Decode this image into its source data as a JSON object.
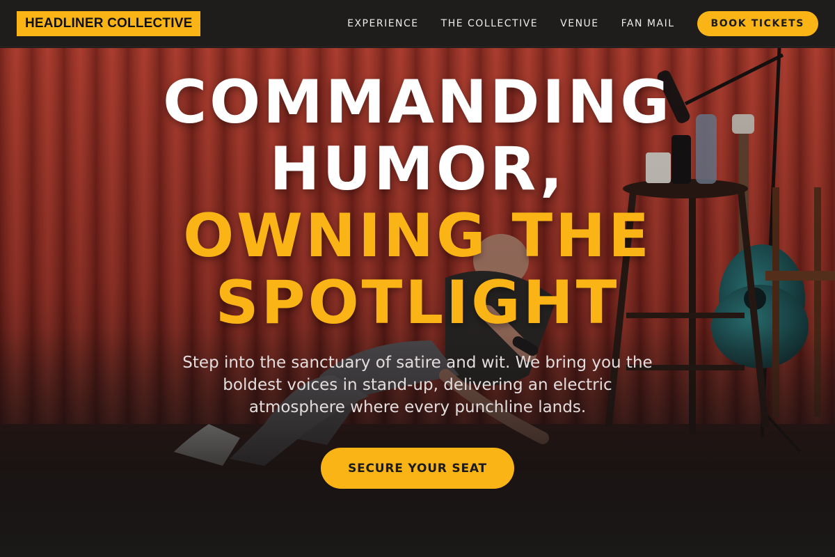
{
  "brand": {
    "logo_text": "HEADLINER COLLECTIVE"
  },
  "nav": {
    "links": [
      {
        "label": "EXPERIENCE"
      },
      {
        "label": "THE COLLECTIVE"
      },
      {
        "label": "VENUE"
      },
      {
        "label": "FAN MAIL"
      }
    ],
    "cta_label": "BOOK TICKETS"
  },
  "hero": {
    "headline_white_1": "COMMANDING",
    "headline_white_2": "HUMOR,",
    "headline_accent_1": "OWNING THE",
    "headline_accent_2": "SPOTLIGHT",
    "subtitle": "Step into the sanctuary of satire and wit. We bring you the boldest voices in stand-up, delivering an electric atmosphere where every punchline lands.",
    "cta_label": "SECURE YOUR SEAT"
  },
  "colors": {
    "accent": "#fbb415",
    "background": "#1b1818",
    "nav_background": "#1f1c1c"
  }
}
